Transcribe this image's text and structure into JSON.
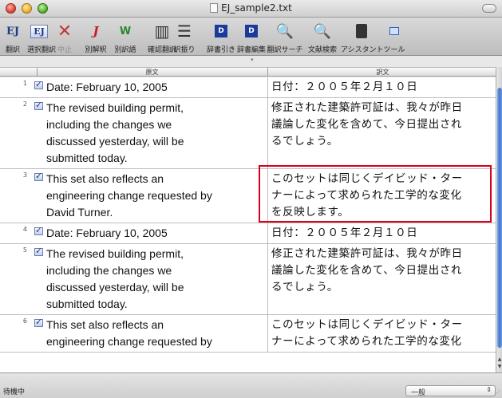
{
  "window": {
    "title": "EJ_sample2.txt"
  },
  "toolbar": [
    {
      "label": "翻訳",
      "icon": "EJ",
      "icon_name": "translate-icon",
      "dim": false
    },
    {
      "label": "選択翻訳",
      "icon": "EJ",
      "icon_name": "select-translate-icon",
      "dim": false
    },
    {
      "label": "中止",
      "icon": "✕",
      "icon_name": "stop-icon",
      "dim": true
    },
    {
      "label": "別解釈",
      "icon": "J",
      "icon_name": "alt-interpretation-icon",
      "dim": false
    },
    {
      "label": "別訳語",
      "icon": "W",
      "icon_name": "alt-term-icon",
      "dim": false
    },
    {
      "label": "確認翻訳",
      "icon": "▥",
      "icon_name": "confirm-translate-icon",
      "dim": false
    },
    {
      "label": "訳振り",
      "icon": "☰",
      "icon_name": "ruby-translation-icon",
      "dim": false
    },
    {
      "label": "辞書引き",
      "icon": "D",
      "icon_name": "dictionary-lookup-icon",
      "dim": false
    },
    {
      "label": "辞書編集",
      "icon": "D",
      "icon_name": "dictionary-edit-icon",
      "dim": false
    },
    {
      "label": "翻訳サーチ",
      "icon": "🔍",
      "icon_name": "translation-search-icon",
      "dim": false
    },
    {
      "label": "文献検索",
      "icon": "🔍",
      "icon_name": "literature-search-icon",
      "dim": false
    },
    {
      "label": "アシスタント",
      "icon": "▮",
      "icon_name": "assistant-icon",
      "dim": false
    },
    {
      "label": "ツール",
      "icon": "▭",
      "icon_name": "tools-icon",
      "dim": false
    }
  ],
  "columns": {
    "source": "原文",
    "target": "訳文"
  },
  "rows": [
    {
      "num": "1",
      "source": [
        "Date: February 10, 2005"
      ],
      "target": [
        "日付：２００５年２月１０日"
      ]
    },
    {
      "num": "2",
      "source": [
        "The revised building permit,",
        "including the changes we",
        "discussed yesterday, will be",
        "submitted today."
      ],
      "target": [
        "修正された建築許可証は、我々が昨日",
        "議論した変化を含めて、今日提出され",
        "るでしょう。"
      ]
    },
    {
      "num": "3",
      "source": [
        "This set also reflects an",
        "engineering change requested by",
        "David Turner."
      ],
      "target": [
        "このセットは同じくデイビッド・ター",
        "ナーによって求められた工学的な変化",
        "を反映します。"
      ]
    },
    {
      "num": "4",
      "source": [
        "Date: February 10, 2005"
      ],
      "target": [
        "日付：２００５年２月１０日"
      ]
    },
    {
      "num": "5",
      "source": [
        "The revised building permit,",
        "including the changes we",
        "discussed yesterday, will be",
        "submitted today."
      ],
      "target": [
        "修正された建築許可証は、我々が昨日",
        "議論した変化を含めて、今日提出され",
        "るでしょう。"
      ]
    },
    {
      "num": "6",
      "source": [
        "This set also reflects an",
        "engineering change requested by"
      ],
      "target": [
        "このセットは同じくデイビッド・ター",
        "ナーによって求められた工学的な変化"
      ]
    }
  ],
  "status": {
    "text": "待機中",
    "mode": "一般"
  }
}
